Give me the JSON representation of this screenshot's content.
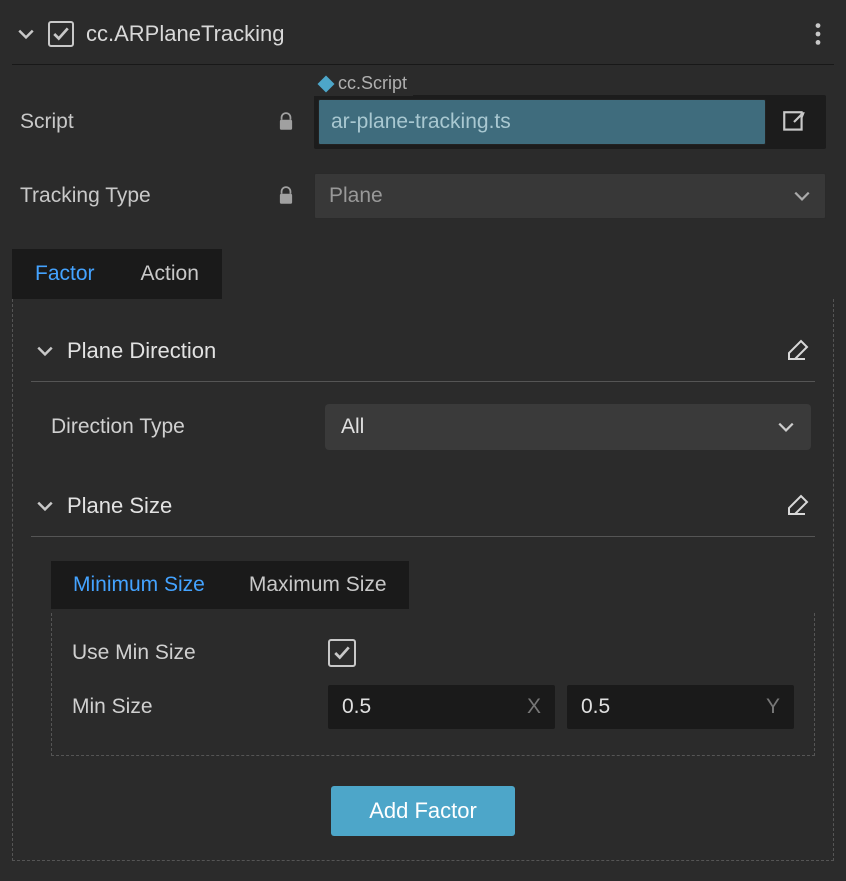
{
  "header": {
    "title": "cc.ARPlaneTracking",
    "checked": true
  },
  "script": {
    "label": "Script",
    "tag_label": "cc.Script",
    "value": "ar-plane-tracking.ts"
  },
  "tracking": {
    "label": "Tracking Type",
    "value": "Plane"
  },
  "tabs": {
    "factor": "Factor",
    "action": "Action"
  },
  "plane_direction": {
    "title": "Plane Direction",
    "dir_label": "Direction Type",
    "dir_value": "All"
  },
  "plane_size": {
    "title": "Plane Size",
    "sub_tabs": {
      "min": "Minimum Size",
      "max": "Maximum Size"
    },
    "use_min_label": "Use Min Size",
    "use_min_checked": true,
    "min_label": "Min Size",
    "x_value": "0.5",
    "y_value": "0.5",
    "x_suffix": "X",
    "y_suffix": "Y"
  },
  "add_btn": "Add Factor"
}
